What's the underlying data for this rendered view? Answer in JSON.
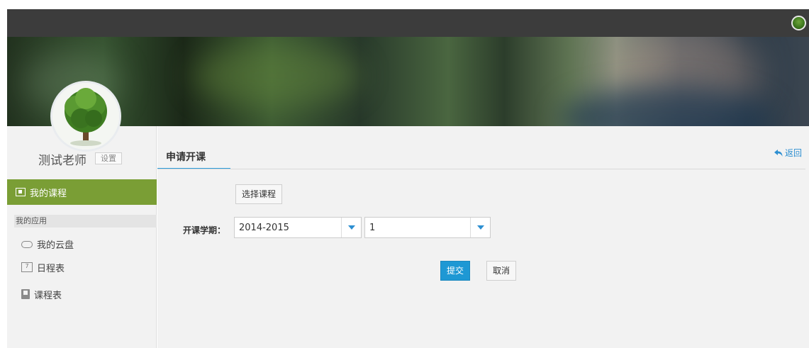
{
  "header": {
    "avatar_icon": "tree-avatar-icon"
  },
  "profile": {
    "name": "测试老师",
    "settings_label": "设置"
  },
  "sidebar": {
    "active_item": {
      "label": "我的课程",
      "icon": "course-icon"
    },
    "section_label": "我的应用",
    "items": [
      {
        "label": "我的云盘",
        "icon": "cloud-icon"
      },
      {
        "label": "日程表",
        "icon": "calendar-icon"
      },
      {
        "label": "课程表",
        "icon": "book-icon"
      }
    ]
  },
  "main": {
    "tab_label": "申请开课",
    "back_label": "返回",
    "select_course_label": "选择课程",
    "term_label": "开课学期：",
    "year_select_value": "2014-2015",
    "term_select_value": "1",
    "submit_label": "提交",
    "cancel_label": "取消"
  },
  "colors": {
    "topbar": "#3c3c3c",
    "accent_green": "#7a9e35",
    "accent_blue": "#1e98d4",
    "link_blue": "#2d8fd1"
  }
}
